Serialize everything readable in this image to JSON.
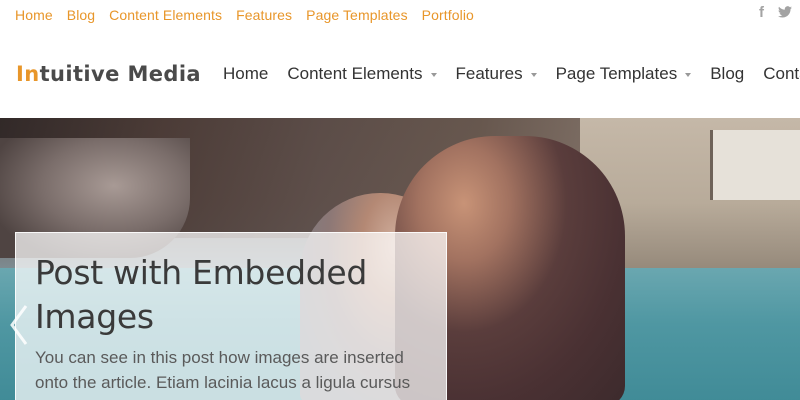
{
  "topbar": {
    "links": [
      "Home",
      "Blog",
      "Content Elements",
      "Features",
      "Page Templates",
      "Portfolio"
    ],
    "social": {
      "facebook": "f",
      "twitter": "t"
    }
  },
  "brand": {
    "accent": "In",
    "rest": "tuitive Media",
    "accent_color": "#e8962a"
  },
  "nav": {
    "items": [
      {
        "label": "Home",
        "has_dropdown": false
      },
      {
        "label": "Content Elements",
        "has_dropdown": true
      },
      {
        "label": "Features",
        "has_dropdown": true
      },
      {
        "label": "Page Templates",
        "has_dropdown": true
      },
      {
        "label": "Blog",
        "has_dropdown": false
      },
      {
        "label": "Conta",
        "has_dropdown": false
      }
    ]
  },
  "slider": {
    "title": "Post with Embedded Images",
    "excerpt": "You can see in this post how images are inserted onto the article. Etiam lacinia lacus a ligula cursus"
  }
}
